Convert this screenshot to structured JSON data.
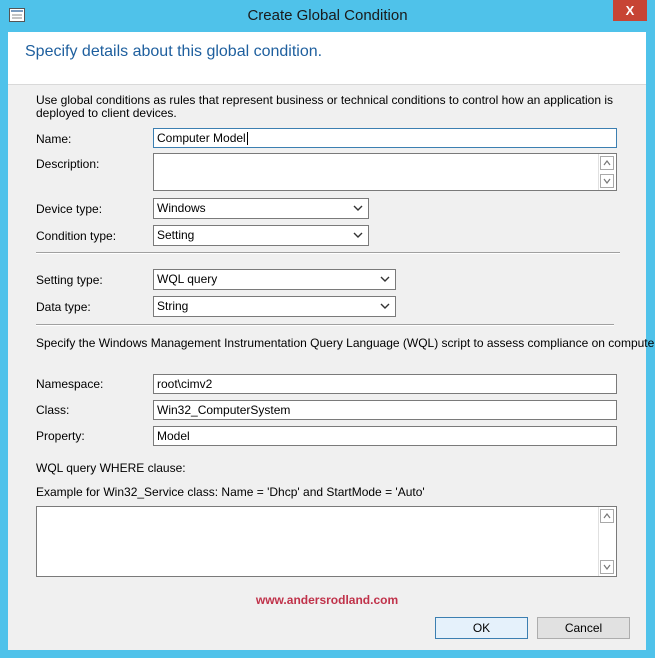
{
  "window": {
    "title": "Create Global Condition",
    "close_glyph": "X"
  },
  "heading": "Specify details about this global condition.",
  "intro": "Use global conditions as rules that represent business or technical conditions to control how an application is deployed to client devices.",
  "fields": {
    "name": {
      "label": "Name:",
      "value": "Computer Model"
    },
    "description": {
      "label": "Description:",
      "value": ""
    },
    "device_type": {
      "label": "Device type:",
      "value": "Windows"
    },
    "condition_type": {
      "label": "Condition type:",
      "value": "Setting"
    },
    "setting_type": {
      "label": "Setting type:",
      "value": "WQL query"
    },
    "data_type": {
      "label": "Data type:",
      "value": "String"
    }
  },
  "wql_info": "Specify the Windows Management Instrumentation Query Language (WQL) script to assess compliance on computers.",
  "wql": {
    "namespace": {
      "label": "Namespace:",
      "value": "root\\cimv2"
    },
    "class": {
      "label": "Class:",
      "value": "Win32_ComputerSystem"
    },
    "property": {
      "label": "Property:",
      "value": "Model"
    },
    "where_label": "WQL query WHERE clause:",
    "example": "Example for Win32_Service class: Name = 'Dhcp' and StartMode = 'Auto'",
    "where_value": ""
  },
  "watermark": "www.andersrodland.com",
  "buttons": {
    "ok": "OK",
    "cancel": "Cancel"
  },
  "colors": {
    "title_bg": "#4fc2ea",
    "close_bg": "#c74434",
    "heading": "#1e5f9e",
    "watermark": "#c0324a"
  }
}
